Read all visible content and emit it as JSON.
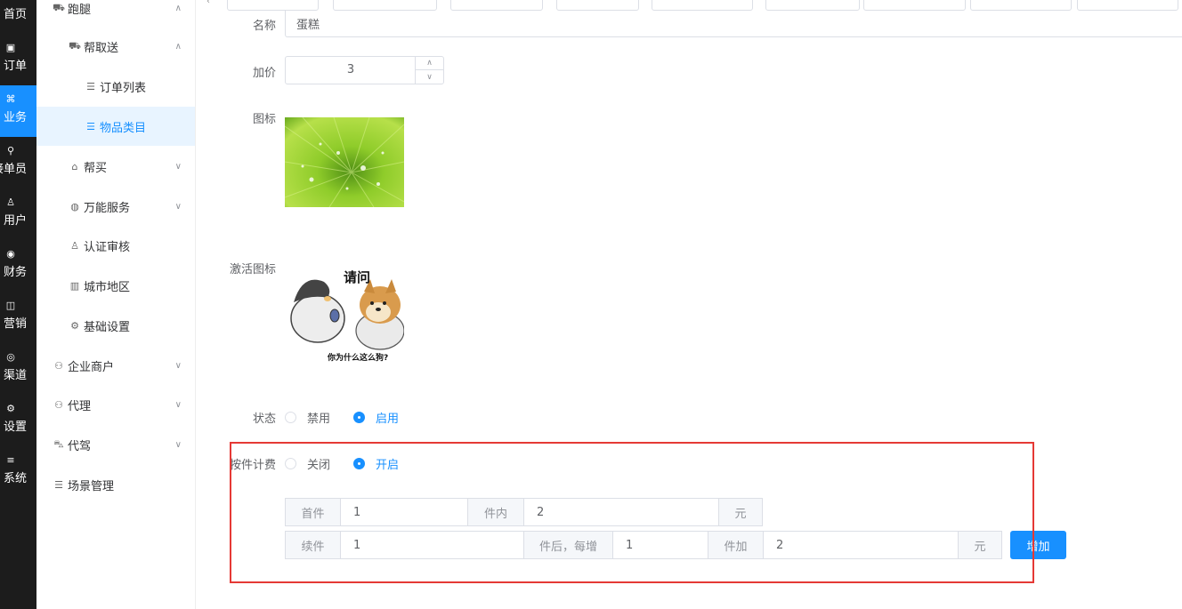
{
  "rail": [
    {
      "label": "首页",
      "icon": "home-icon",
      "glyph": "⌂"
    },
    {
      "label": "订单",
      "icon": "order-icon",
      "glyph": "▣"
    },
    {
      "label": "业务",
      "icon": "business-icon",
      "glyph": "⌘"
    },
    {
      "label": "接单员",
      "icon": "rider-icon",
      "glyph": "⚲"
    },
    {
      "label": "用户",
      "icon": "user-icon",
      "glyph": "♙"
    },
    {
      "label": "财务",
      "icon": "finance-icon",
      "glyph": "◉"
    },
    {
      "label": "营销",
      "icon": "marketing-icon",
      "glyph": "◫"
    },
    {
      "label": "渠道",
      "icon": "channel-icon",
      "glyph": "◎"
    },
    {
      "label": "设置",
      "icon": "settings-icon",
      "glyph": "⚙"
    },
    {
      "label": "系统",
      "icon": "system-icon",
      "glyph": "≡"
    }
  ],
  "sidebar": {
    "items": [
      {
        "label": "跑腿",
        "icon": "errand-icon",
        "glyph": "⛟",
        "chevron": "∧"
      },
      {
        "label": "帮取送",
        "icon": "delivery-icon",
        "glyph": "⛟",
        "chevron": "∧"
      },
      {
        "label": "订单列表",
        "icon": "list-icon",
        "glyph": "☰"
      },
      {
        "label": "物品类目",
        "icon": "list-icon",
        "glyph": "☰"
      },
      {
        "label": "帮买",
        "icon": "basket-icon",
        "glyph": "⌂",
        "chevron": "∨"
      },
      {
        "label": "万能服务",
        "icon": "globe-icon",
        "glyph": "◍",
        "chevron": "∨"
      },
      {
        "label": "认证审核",
        "icon": "user-check-icon",
        "glyph": "♙"
      },
      {
        "label": "城市地区",
        "icon": "city-icon",
        "glyph": "▥"
      },
      {
        "label": "基础设置",
        "icon": "gear-icon",
        "glyph": "⚙"
      },
      {
        "label": "企业商户",
        "icon": "merchant-icon",
        "glyph": "⚇",
        "chevron": "∨"
      },
      {
        "label": "代理",
        "icon": "agent-icon",
        "glyph": "⚇",
        "chevron": "∨"
      },
      {
        "label": "代驾",
        "icon": "car-icon",
        "glyph": "⛍",
        "chevron": "∨"
      },
      {
        "label": "场景管理",
        "icon": "scene-icon",
        "glyph": "☰"
      }
    ]
  },
  "tabs": {
    "arrow": "‹"
  },
  "form": {
    "name_label": "名称",
    "name_value": "蛋糕",
    "price_label": "加价",
    "price_value": "3",
    "stepper_up": "∧",
    "stepper_down": "∨",
    "icon_label": "图标",
    "active_icon_label": "激活图标",
    "meme_title": "请问",
    "meme_caption": "你为什么这么狗?",
    "status_label": "状态",
    "status_options": [
      "禁用",
      "启用"
    ],
    "status_selected": "启用",
    "piece_label": "按件计费",
    "piece_options": [
      "关闭",
      "开启"
    ],
    "piece_selected": "开启",
    "row1": {
      "first_label": "首件",
      "first_value": "1",
      "within_label": "件内",
      "within_value": "2",
      "unit": "元"
    },
    "row2": {
      "cont_label": "续件",
      "cont_value": "1",
      "after_label": "件后，每增",
      "after_value": "1",
      "add_label": "件加",
      "add_value": "2",
      "unit": "元"
    },
    "add_button": "增加"
  },
  "colors": {
    "accent": "#1890ff",
    "highlight_box": "#e53935"
  }
}
